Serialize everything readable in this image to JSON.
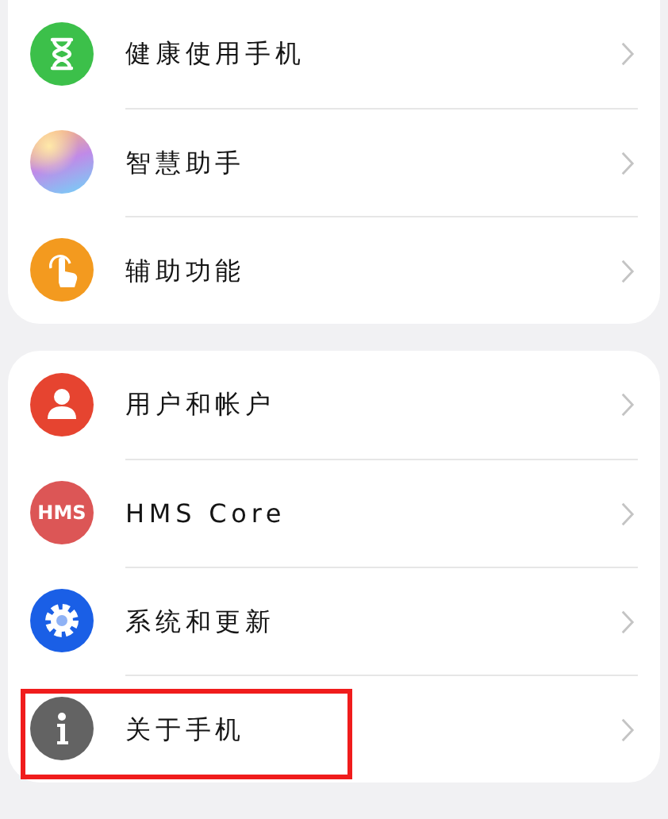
{
  "groups": [
    {
      "items": [
        {
          "label": "健康使用手机",
          "kind": "hourglass",
          "color": "#3cc04a",
          "highlighted": false
        },
        {
          "label": "智慧助手",
          "kind": "gradient",
          "color": "#c08ae8",
          "highlighted": false
        },
        {
          "label": "辅助功能",
          "kind": "hand",
          "color": "#f39a1f",
          "highlighted": false
        }
      ]
    },
    {
      "items": [
        {
          "label": "用户和帐户",
          "kind": "person",
          "color": "#e64430",
          "highlighted": false
        },
        {
          "label": "HMS Core",
          "kind": "text",
          "icon_text": "HMS",
          "color": "#dc5656",
          "highlighted": false
        },
        {
          "label": "系统和更新",
          "kind": "gear",
          "color": "#1a5fe6",
          "highlighted": false
        },
        {
          "label": "关于手机",
          "kind": "info",
          "color": "#636363",
          "highlighted": true
        }
      ]
    }
  ]
}
